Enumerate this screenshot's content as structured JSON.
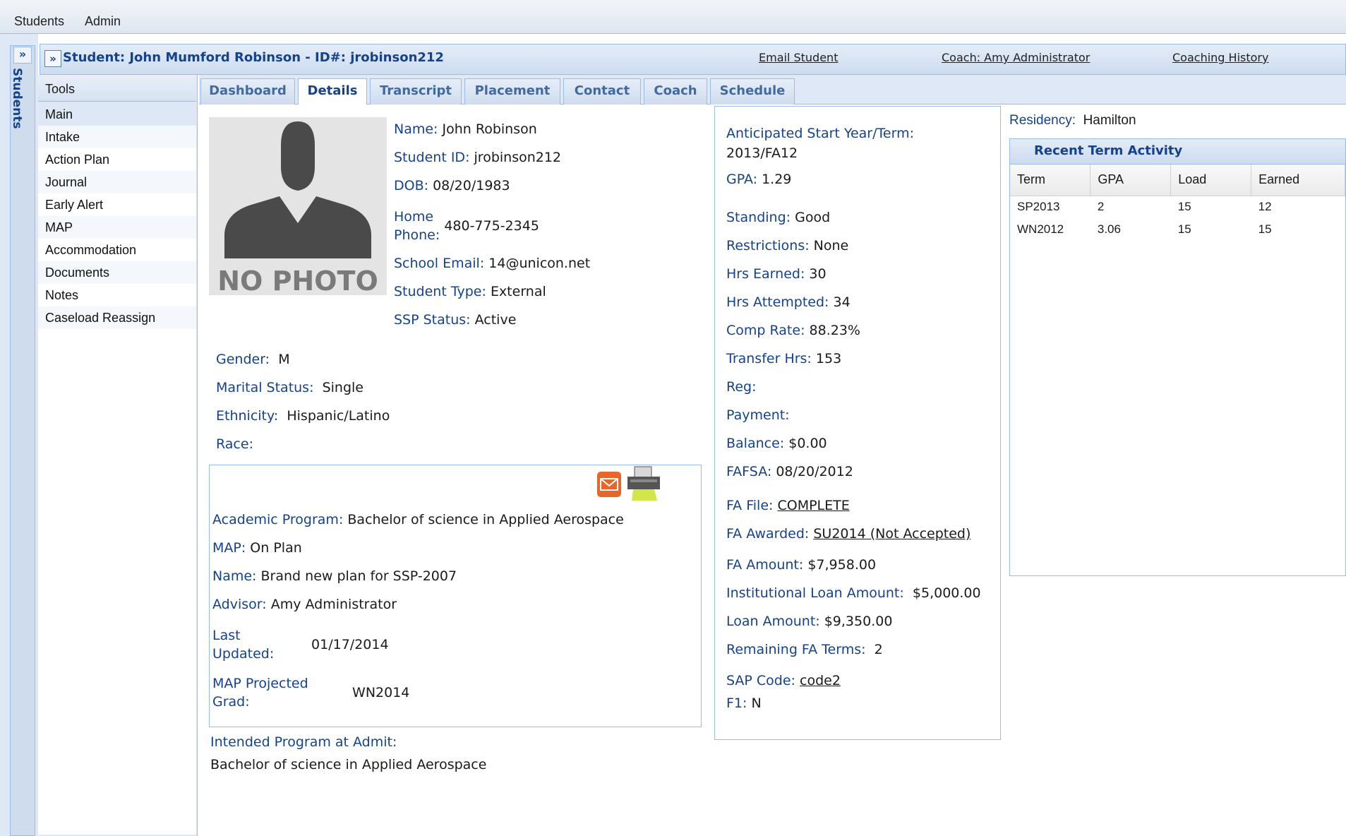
{
  "topbar": {
    "menu": [
      "Students",
      "Admin"
    ]
  },
  "strip": {
    "expander": "»",
    "label": "Students"
  },
  "header": {
    "expander": "»",
    "title": "Student: John Mumford Robinson - ID#: jrobinson212",
    "email_link": "Email Student",
    "coach_link": "Coach: Amy Administrator",
    "history_link": "Coaching History",
    "user_icon": "user-coach-icon"
  },
  "tools": {
    "title": "Tools",
    "items": [
      "Main",
      "Intake",
      "Action Plan",
      "Journal",
      "Early Alert",
      "MAP",
      "Accommodation",
      "Documents",
      "Notes",
      "Caseload Reassign"
    ],
    "selected": "Main"
  },
  "tabs": {
    "items": [
      "Dashboard",
      "Details",
      "Transcript",
      "Placement",
      "Contact",
      "Coach",
      "Schedule"
    ],
    "active": "Details"
  },
  "profile": {
    "photo_text": "NO PHOTO",
    "name_label": "Name:",
    "name": "John Robinson",
    "id_label": "Student ID:",
    "id": "jrobinson212",
    "dob_label": "DOB:",
    "dob": "08/20/1983",
    "phone_label_1": "Home",
    "phone_label_2": "Phone:",
    "phone": "480-775-2345",
    "email_label": "School Email:",
    "email": "14@unicon.net",
    "type_label": "Student Type:",
    "type": "External",
    "ssp_label": "SSP Status:",
    "ssp": "Active",
    "gender_label": "Gender:",
    "gender": "M",
    "marital_label": "Marital Status:",
    "marital": "Single",
    "ethnicity_label": "Ethnicity:",
    "ethnicity": "Hispanic/Latino",
    "race_label": "Race:",
    "race": ""
  },
  "program": {
    "email_icon": "email-icon",
    "print_icon": "printer-icon",
    "academic_label": "Academic Program:",
    "academic": "Bachelor of science in Applied Aerospace",
    "map_label": "MAP:",
    "map": "On Plan",
    "plan_label": "Name:",
    "plan": "Brand new plan for SSP-2007",
    "advisor_label": "Advisor:",
    "advisor": "Amy Administrator",
    "updated_label_1": "Last",
    "updated_label_2": "Updated:",
    "updated": "01/17/2014",
    "grad_label_1": "MAP Projected",
    "grad_label_2": "Grad:",
    "grad": "WN2014",
    "intended_label": "Intended Program at Admit:",
    "intended": "Bachelor of science in Applied Aerospace"
  },
  "academics": {
    "start_label": "Anticipated Start Year/Term:",
    "start": "2013/FA12",
    "gpa_label": "GPA:",
    "gpa": "1.29",
    "standing_label": "Standing:",
    "standing": "Good",
    "restrictions_label": "Restrictions:",
    "restrictions": "None",
    "earned_label": "Hrs Earned:",
    "earned": "30",
    "attempted_label": "Hrs Attempted:",
    "attempted": "34",
    "comp_label": "Comp Rate:",
    "comp": "88.23%",
    "transfer_label": "Transfer Hrs:",
    "transfer": "153",
    "reg_label": "Reg:",
    "reg": "",
    "payment_label": "Payment:",
    "payment": "",
    "balance_label": "Balance:",
    "balance": "$0.00",
    "fafsa_label": "FAFSA:",
    "fafsa": "08/20/2012",
    "fafile_label": "FA File:",
    "fafile": "COMPLETE",
    "faawarded_label": "FA Awarded:",
    "faawarded": "SU2014 (Not Accepted)",
    "faamount_label": "FA Amount:",
    "faamount": "$7,958.00",
    "instloan_label": "Institutional Loan Amount:",
    "instloan": "$5,000.00",
    "loan_label": "Loan Amount:",
    "loan": "$9,350.00",
    "remaining_label": "Remaining FA Terms:",
    "remaining": "2",
    "sap_label": "SAP Code:",
    "sap": "code2",
    "f1_label": "F1:",
    "f1": "N"
  },
  "residency": {
    "label": "Residency:",
    "value": "Hamilton"
  },
  "recent_activity": {
    "title": "Recent Term Activity",
    "columns": [
      "Term",
      "GPA",
      "Load",
      "Earned"
    ],
    "rows": [
      [
        "SP2013",
        "2",
        "15",
        "12"
      ],
      [
        "WN2012",
        "3.06",
        "15",
        "15"
      ]
    ]
  }
}
